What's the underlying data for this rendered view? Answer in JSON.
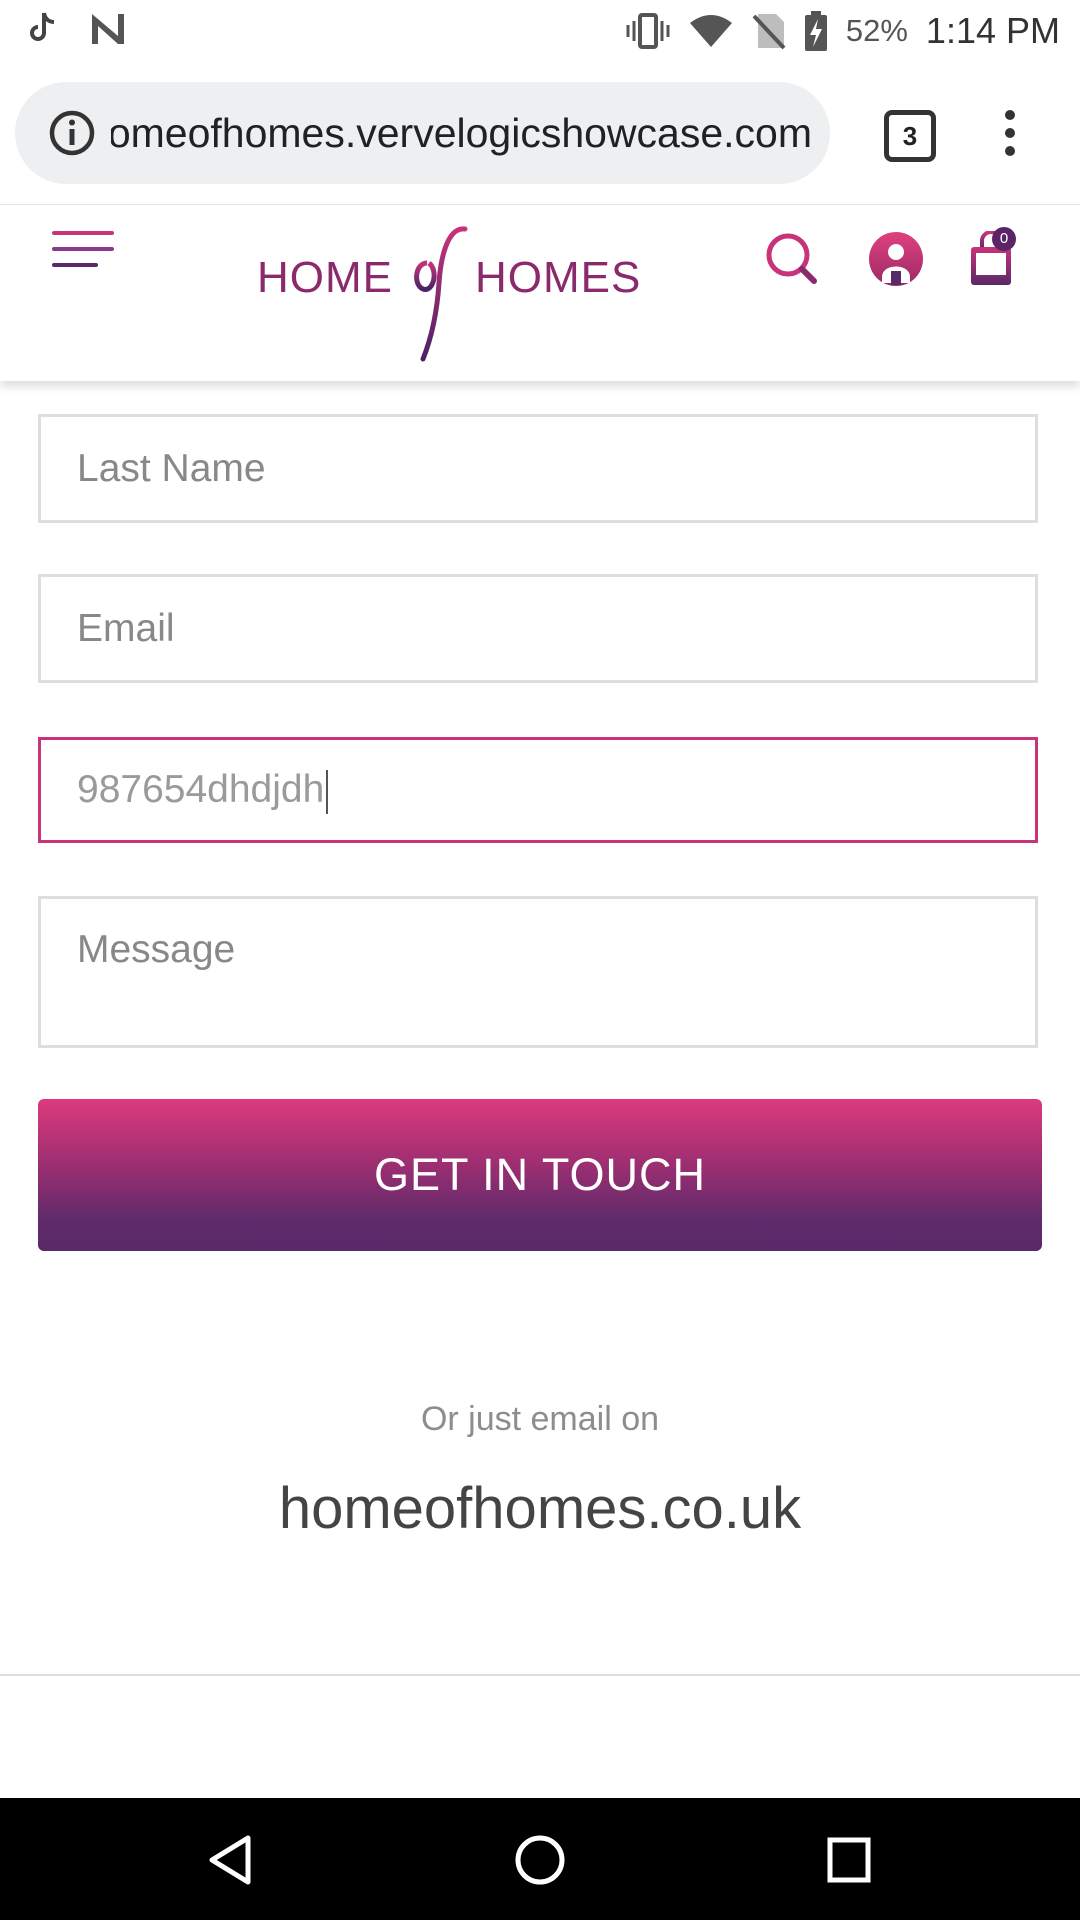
{
  "status_bar": {
    "time": "1:14 PM",
    "battery_percent": "52%",
    "icons": [
      "tiktok-icon",
      "n-icon",
      "vibrate-icon",
      "wifi-icon",
      "no-sim-icon",
      "battery-charging-icon"
    ]
  },
  "browser": {
    "url": "homeofhomes.vervelogicshowcase.com",
    "tab_count": "3"
  },
  "header": {
    "logo_left": "HOME",
    "logo_right": "HOMES",
    "cart_count": "0",
    "brand_pink": "#c8337a",
    "brand_purple": "#5a2968"
  },
  "form": {
    "last_name_placeholder": "Last Name",
    "email_placeholder": "Email",
    "phone_value": "987654dhdjdh",
    "message_placeholder": "Message",
    "submit_label": "GET IN TOUCH"
  },
  "contact": {
    "or_text": "Or just email on",
    "email_domain": "homeofhomes.co.uk"
  }
}
